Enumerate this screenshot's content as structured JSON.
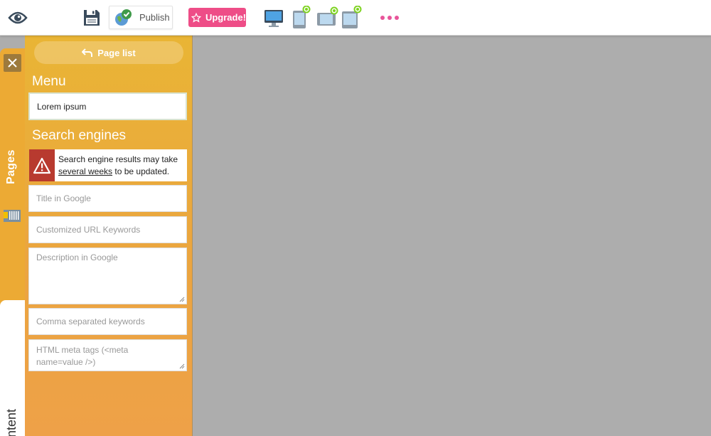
{
  "toolbar": {
    "preview_icon": "eye-icon",
    "save_icon": "floppy-disk-icon",
    "publish_label": "Publish",
    "upgrade_label": "Upgrade!",
    "devices": [
      "desktop-icon",
      "tablet-portrait-icon",
      "tablet-landscape-icon",
      "phone-icon"
    ],
    "more_icon": "ellipsis-icon"
  },
  "tabs": {
    "pages_label": "Pages",
    "content_label": "ntent"
  },
  "panel": {
    "page_list_label": "Page list",
    "menu_title": "Menu",
    "menu_value": "Lorem ipsum",
    "seo_title": "Search engines",
    "warning_prefix": "Search engine results may take ",
    "warning_link": "several weeks",
    "warning_suffix": " to be updated.",
    "placeholders": {
      "title": "Title in Google",
      "url": "Customized URL Keywords",
      "description": "Description in Google",
      "keywords": "Comma separated keywords",
      "meta": "HTML meta tags (<meta name=value />)"
    }
  },
  "colors": {
    "accent_orange": "#ecaa34",
    "upgrade_pink": "#ee4d87",
    "warning_red": "#b83a2f",
    "device_badge_green": "#7ed321"
  }
}
